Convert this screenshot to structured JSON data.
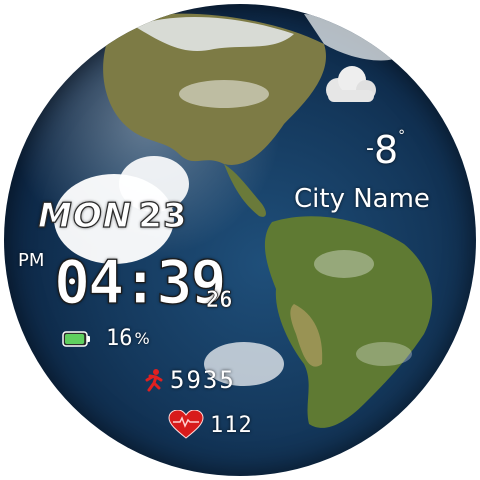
{
  "watchface": {
    "date": {
      "weekday": "MON",
      "day": "23"
    },
    "time": {
      "ampm": "PM",
      "hhmm": "04:39",
      "seconds": "26"
    },
    "battery": {
      "value": "16",
      "unit": "%",
      "level": 0.16
    },
    "steps": {
      "value": "5935"
    },
    "heart_rate": {
      "value": "112"
    },
    "weather": {
      "icon": "cloud-icon",
      "temperature": "8",
      "sign": "-",
      "degree": "°",
      "city": "City Name"
    }
  },
  "colors": {
    "ocean": "#14385c",
    "land": "#6f7a3a",
    "steps_icon": "#e02020",
    "heart_icon": "#d81b1b",
    "battery_fill": "#5fcf5f",
    "text": "#ffffff"
  }
}
